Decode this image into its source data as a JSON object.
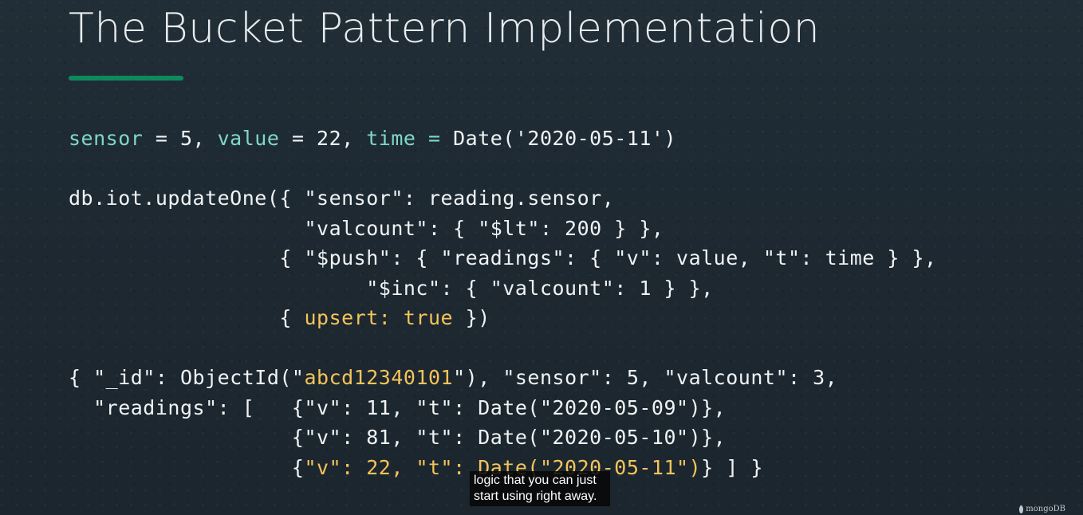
{
  "slide": {
    "title": "The Bucket Pattern Implementation",
    "accent_color": "#0e8a5a",
    "code_lines": [
      [
        {
          "text": "sensor",
          "class": "tk-teal"
        },
        {
          "text": " = 5, ",
          "class": "tk-plain"
        },
        {
          "text": "value",
          "class": "tk-teal"
        },
        {
          "text": " = 22, ",
          "class": "tk-plain"
        },
        {
          "text": "time = ",
          "class": "tk-teal"
        },
        {
          "text": "Date('2020-05-11')",
          "class": "tk-plain"
        }
      ],
      [],
      [
        {
          "text": "db.iot.updateOne({ \"sensor\": reading.sensor,",
          "class": "tk-plain"
        }
      ],
      [
        {
          "text": "                   \"valcount\": { \"$lt\": 200 } },",
          "class": "tk-plain"
        }
      ],
      [
        {
          "text": "                 { \"$push\": { \"readings\": { \"v\": value, \"t\": time } },",
          "class": "tk-plain"
        }
      ],
      [
        {
          "text": "                        \"$inc\": { \"valcount\": 1 } },",
          "class": "tk-plain"
        }
      ],
      [
        {
          "text": "                 { ",
          "class": "tk-plain"
        },
        {
          "text": "upsert: true",
          "class": "tk-yellow"
        },
        {
          "text": " })",
          "class": "tk-plain"
        }
      ],
      [],
      [
        {
          "text": "{ \"_id\": ObjectId(\"",
          "class": "tk-plain"
        },
        {
          "text": "abcd12340101",
          "class": "tk-yellow"
        },
        {
          "text": "\"), \"sensor\": 5, \"valcount\": 3,",
          "class": "tk-plain"
        }
      ],
      [
        {
          "text": "  \"readings\": [   {\"v\": 11, \"t\": Date(\"2020-05-09\")},",
          "class": "tk-plain"
        }
      ],
      [
        {
          "text": "                  {\"v\": 81, \"t\": Date(\"2020-05-10\")},",
          "class": "tk-plain"
        }
      ],
      [
        {
          "text": "                  {",
          "class": "tk-plain"
        },
        {
          "text": "\"v\": 22, \"t\": Date(\"2020-05-11\")",
          "class": "tk-yellow"
        },
        {
          "text": "} ] }",
          "class": "tk-plain"
        }
      ]
    ]
  },
  "caption": {
    "line_1": "logic that you can just",
    "line_2": "start using right away."
  },
  "watermark": {
    "text": "mongoDB",
    "icon": "leaf-icon"
  }
}
